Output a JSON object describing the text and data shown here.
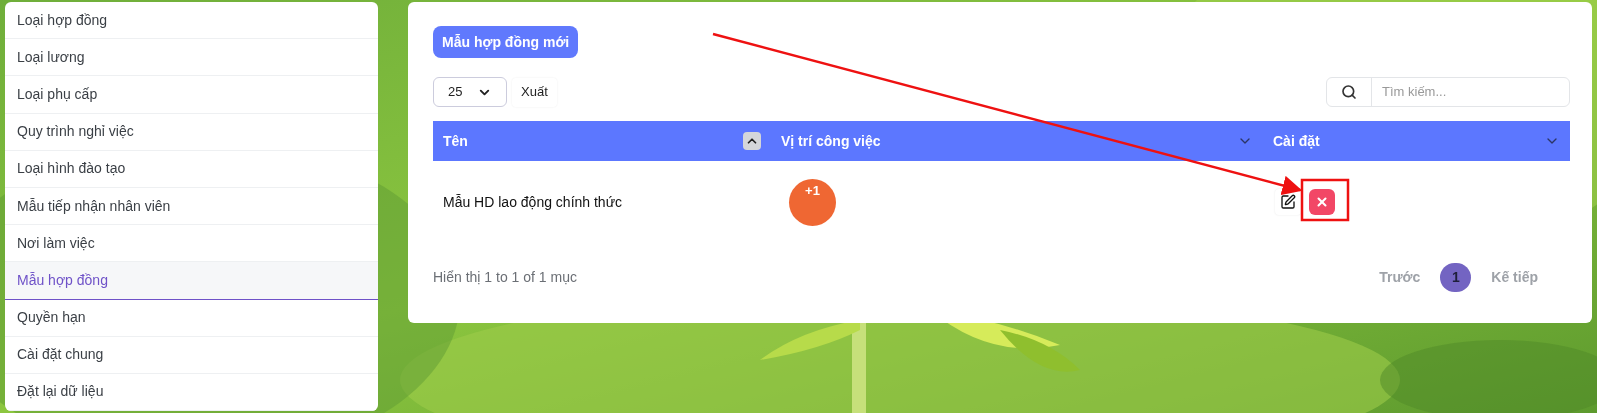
{
  "sidebar": {
    "items": [
      {
        "label": "Loại hợp đồng",
        "selected": false
      },
      {
        "label": "Loại lương",
        "selected": false
      },
      {
        "label": "Loại phụ cấp",
        "selected": false
      },
      {
        "label": "Quy trình nghỉ việc",
        "selected": false
      },
      {
        "label": "Loại hình đào tạo",
        "selected": false
      },
      {
        "label": "Mẫu tiếp nhận nhân viên",
        "selected": false
      },
      {
        "label": "Nơi làm việc",
        "selected": false
      },
      {
        "label": "Mẫu hợp đồng",
        "selected": true
      },
      {
        "label": "Quyền hạn",
        "selected": false
      },
      {
        "label": "Cài đặt chung",
        "selected": false
      },
      {
        "label": "Đặt lại dữ liệu",
        "selected": false
      }
    ]
  },
  "panel": {
    "new_button": "Mẫu hợp đồng mới",
    "page_size": "25",
    "export_button": "Xuất",
    "search": {
      "placeholder": "Tìm kiếm..."
    },
    "table": {
      "columns": [
        {
          "label": "Tên",
          "sorted": true
        },
        {
          "label": "Vị trí công việc",
          "sorted": false
        },
        {
          "label": "Cài đặt",
          "sorted": false
        }
      ],
      "rows": [
        {
          "name": "Mẫu HD lao động chính thức",
          "position_badge": "+1"
        }
      ]
    },
    "summary": "Hiển thị 1 to 1 of 1 mục",
    "pagination": {
      "previous": "Trước",
      "pages": [
        {
          "label": "1",
          "selected": true
        }
      ],
      "next": "Kế tiếp"
    }
  },
  "annotations": {
    "arrow": true,
    "highlight_box": true
  }
}
